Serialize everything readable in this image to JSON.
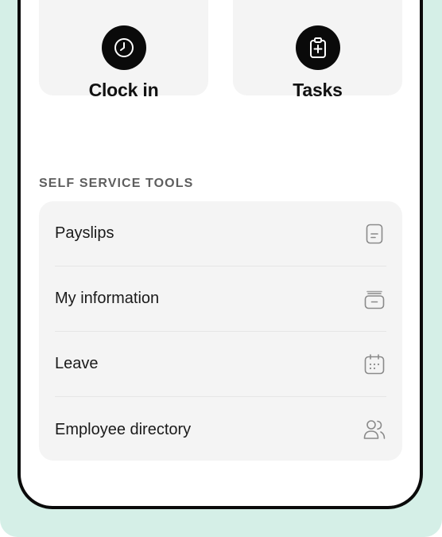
{
  "quick_actions": [
    {
      "label": "Clock in",
      "icon": "clock-icon"
    },
    {
      "label": "Tasks",
      "icon": "clipboard-plus-icon"
    }
  ],
  "self_service": {
    "title": "SELF SERVICE TOOLS",
    "items": [
      {
        "label": "Payslips",
        "icon": "document-icon"
      },
      {
        "label": "My information",
        "icon": "folder-icon"
      },
      {
        "label": "Leave",
        "icon": "calendar-icon"
      },
      {
        "label": "Employee directory",
        "icon": "users-icon"
      }
    ]
  },
  "colors": {
    "backdrop": "#d5efe7",
    "tile": "#f4f4f4",
    "icon_circle": "#0a0a0a",
    "section_title": "#5e5e5e",
    "row_icon": "#8a8a8a"
  }
}
